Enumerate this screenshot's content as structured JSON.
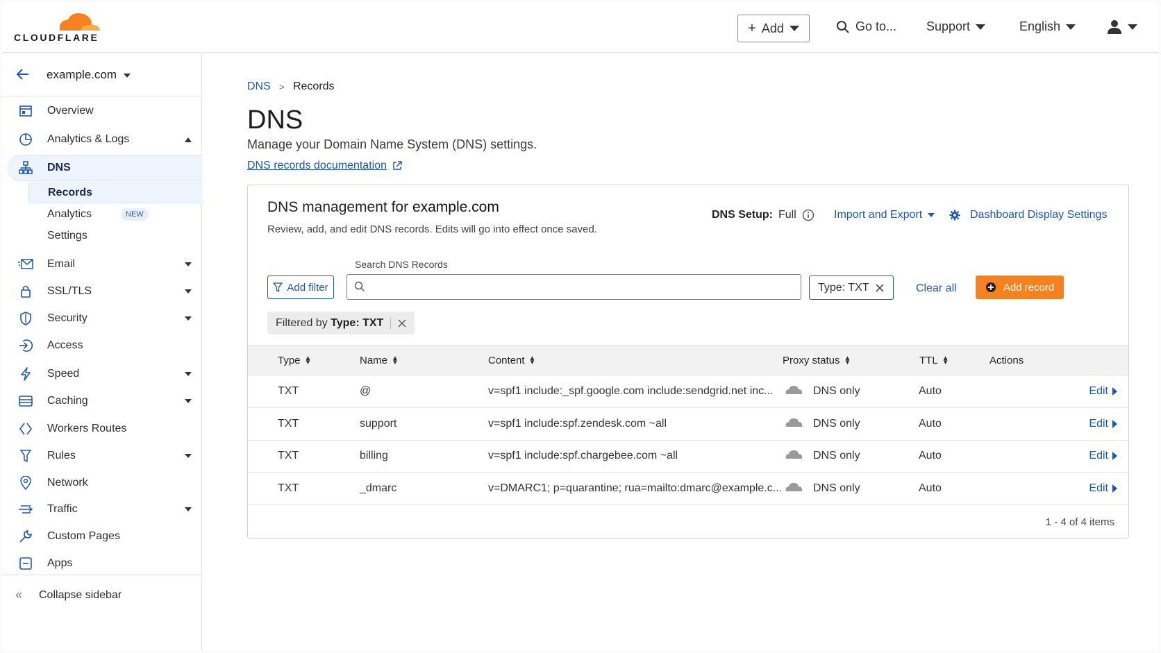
{
  "header": {
    "brand": "CLOUDFLARE",
    "add_label": "Add",
    "goto_label": "Go to...",
    "support_label": "Support",
    "language_label": "English",
    "colors": {
      "brand_orange": "#f6821f",
      "link": "#1a56b5"
    }
  },
  "sidebar": {
    "zone_name": "example.com",
    "items": [
      {
        "label": "Overview",
        "icon": "overview-icon"
      },
      {
        "label": "Analytics & Logs",
        "icon": "analytics-icon"
      },
      {
        "label": "DNS",
        "icon": "dns-icon"
      },
      {
        "label": "Email",
        "icon": "email-icon"
      },
      {
        "label": "SSL/TLS",
        "icon": "lock-icon"
      },
      {
        "label": "Security",
        "icon": "shield-icon"
      },
      {
        "label": "Access",
        "icon": "access-icon"
      },
      {
        "label": "Speed",
        "icon": "lightning-icon"
      },
      {
        "label": "Caching",
        "icon": "caching-icon"
      },
      {
        "label": "Workers Routes",
        "icon": "workers-icon"
      },
      {
        "label": "Rules",
        "icon": "rules-icon"
      },
      {
        "label": "Network",
        "icon": "location-pin-icon"
      },
      {
        "label": "Traffic",
        "icon": "traffic-icon"
      },
      {
        "label": "Custom Pages",
        "icon": "wrench-icon"
      },
      {
        "label": "Apps",
        "icon": "apps-icon"
      }
    ],
    "dns_sub": [
      {
        "label": "Records"
      },
      {
        "label": "Analytics",
        "badge": "NEW"
      },
      {
        "label": "Settings"
      }
    ],
    "collapse_label": "Collapse sidebar"
  },
  "breadcrumb": {
    "parent": "DNS",
    "current": "Records"
  },
  "page": {
    "title": "DNS",
    "description": "Manage your Domain Name System (DNS) settings.",
    "doc_link": "DNS records documentation"
  },
  "card": {
    "title_prefix": "DNS management for",
    "title_domain": "example.com",
    "subtitle": "Review, add, and edit DNS records. Edits will go into effect once saved.",
    "setup_key": "DNS Setup:",
    "setup_value": "Full",
    "import_export": "Import and Export",
    "display_settings": "Dashboard Display Settings",
    "search_label": "Search DNS Records",
    "search_placeholder": "",
    "add_filter": "Add filter",
    "type_chip": "Type: TXT",
    "clear_all": "Clear all",
    "add_record": "Add record",
    "filtered_prefix": "Filtered by",
    "filtered_value": "Type: TXT",
    "columns": [
      "Type",
      "Name",
      "Content",
      "Proxy status",
      "TTL",
      "Actions"
    ],
    "rows": [
      {
        "type": "TXT",
        "name": "@",
        "content": "v=spf1 include:_spf.google.com include:sendgrid.net inc...",
        "proxy": "DNS only",
        "ttl": "Auto",
        "action": "Edit"
      },
      {
        "type": "TXT",
        "name": "support",
        "content": "v=spf1 include:spf.zendesk.com ~all",
        "proxy": "DNS only",
        "ttl": "Auto",
        "action": "Edit"
      },
      {
        "type": "TXT",
        "name": "billing",
        "content": "v=spf1 include:spf.chargebee.com ~all",
        "proxy": "DNS only",
        "ttl": "Auto",
        "action": "Edit"
      },
      {
        "type": "TXT",
        "name": "_dmarc",
        "content": "v=DMARC1; p=quarantine; rua=mailto:dmarc@example.c...",
        "proxy": "DNS only",
        "ttl": "Auto",
        "action": "Edit"
      }
    ],
    "count": "1 - 4 of 4 items"
  }
}
